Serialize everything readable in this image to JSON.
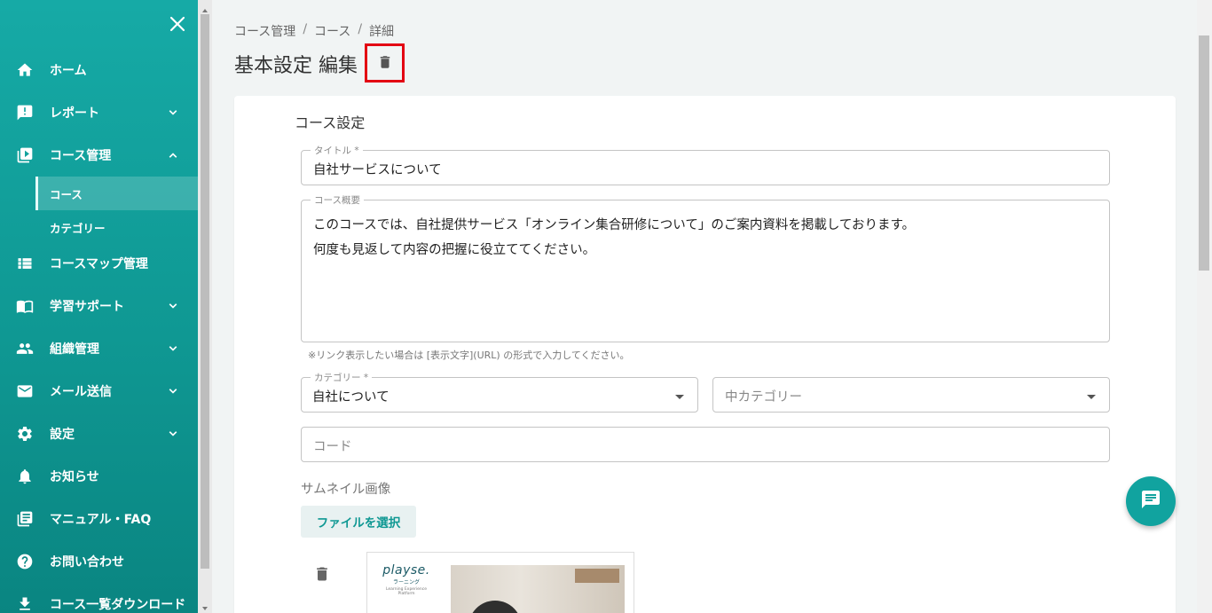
{
  "sidebar": {
    "items": [
      {
        "label": "ホーム",
        "icon": "home-icon"
      },
      {
        "label": "レポート",
        "icon": "report-icon",
        "chevron": "down"
      },
      {
        "label": "コース管理",
        "icon": "course-icon",
        "chevron": "up"
      },
      {
        "label": "コースマップ管理",
        "icon": "list-icon"
      },
      {
        "label": "学習サポート",
        "icon": "book-icon",
        "chevron": "down"
      },
      {
        "label": "組織管理",
        "icon": "people-icon",
        "chevron": "down"
      },
      {
        "label": "メール送信",
        "icon": "mail-icon",
        "chevron": "down"
      },
      {
        "label": "設定",
        "icon": "gear-icon",
        "chevron": "down"
      },
      {
        "label": "お知らせ",
        "icon": "bell-icon"
      },
      {
        "label": "マニュアル・FAQ",
        "icon": "manual-icon"
      },
      {
        "label": "お問い合わせ",
        "icon": "help-icon"
      },
      {
        "label": "コース一覧ダウンロード",
        "icon": "download-icon"
      }
    ],
    "sub_items": [
      {
        "label": "コース",
        "active": true
      },
      {
        "label": "カテゴリー",
        "active": false
      }
    ]
  },
  "breadcrumb": [
    "コース管理",
    "コース",
    "詳細"
  ],
  "breadcrumb_sep": "/",
  "page_title": "基本設定 編集",
  "form": {
    "section_title": "コース設定",
    "title_label": "タイトル *",
    "title_value": "自社サービスについて",
    "summary_label": "コース概要",
    "summary_lines": [
      "このコースでは、自社提供サービス「オンライン集合研修について」のご案内資料を掲載しております。",
      "何度も見返して内容の把握に役立ててください。"
    ],
    "summary_hint": "※リンク表示したい場合は [表示文字](URL) の形式で入力してください。",
    "category_label": "カテゴリー *",
    "category_value": "自社について",
    "subcategory_placeholder": "中カテゴリー",
    "code_placeholder": "コード",
    "thumbnail_label": "サムネイル画像",
    "file_button": "ファイルを選択"
  },
  "preview": {
    "logo_text": "playse.",
    "logo_sub": "ラーニング",
    "logo_tagline": "Learning Experience Platform"
  },
  "colors": {
    "sidebar": "#0f9893",
    "accent": "#11a39f",
    "highlight": "#e30012"
  }
}
